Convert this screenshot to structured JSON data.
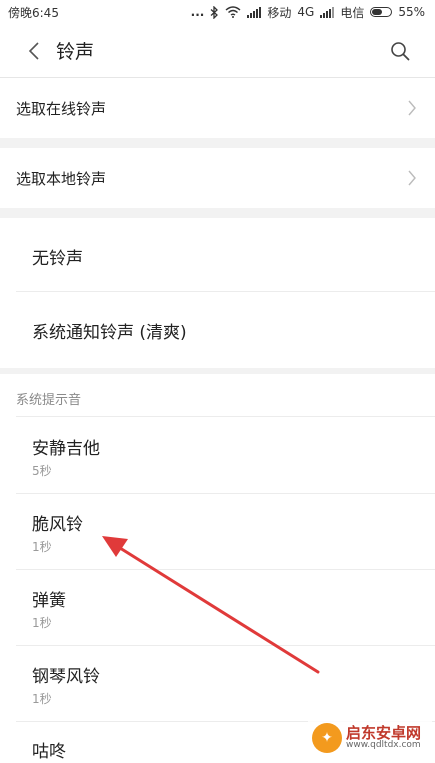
{
  "status_bar": {
    "time": "傍晚6:45",
    "dots": "...",
    "carrier1": "移动",
    "network": "4G",
    "carrier2": "电信",
    "battery_percent": "55%",
    "battery_level": 0.55,
    "icons": [
      "bluetooth-icon",
      "wifi-icon",
      "signal-icon",
      "signal-icon",
      "battery-icon"
    ]
  },
  "header": {
    "title": "铃声",
    "back_icon": "chevron-left-icon",
    "search_icon": "search-icon"
  },
  "nav_rows": [
    {
      "label": "选取在线铃声",
      "icon": "chevron-right-icon"
    },
    {
      "label": "选取本地铃声",
      "icon": "chevron-right-icon"
    }
  ],
  "simple_options": [
    {
      "label": "无铃声"
    },
    {
      "label": "系统通知铃声 (清爽)"
    }
  ],
  "section": {
    "title": "系统提示音"
  },
  "sounds": [
    {
      "title": "安静吉他",
      "duration": "5秒"
    },
    {
      "title": "脆风铃",
      "duration": "1秒"
    },
    {
      "title": "弹簧",
      "duration": "1秒"
    },
    {
      "title": "钢琴风铃",
      "duration": "1秒"
    },
    {
      "title": "咕咚",
      "duration": ""
    }
  ],
  "annotation": {
    "arrow_color": "#e03a3a"
  },
  "watermark": {
    "title": "启东安卓网",
    "url": "www.qdltdx.com"
  }
}
